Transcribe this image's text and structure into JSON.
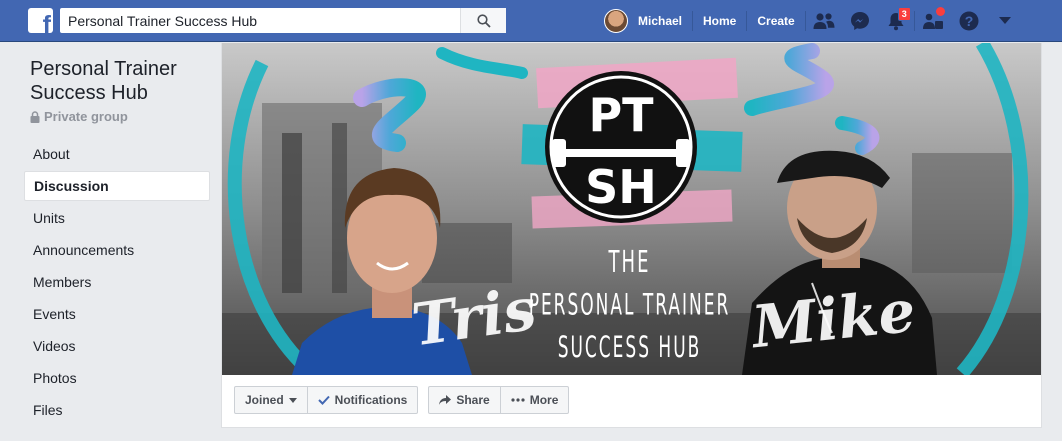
{
  "topbar": {
    "search_value": "Personal Trainer Success Hub",
    "user_name": "Michael",
    "home_label": "Home",
    "create_label": "Create",
    "notifications_count": "3"
  },
  "group": {
    "name_line1": "Personal Trainer",
    "name_line2": "Success Hub",
    "privacy": "Private group"
  },
  "sidebar": {
    "items": [
      {
        "label": "About"
      },
      {
        "label": "Discussion"
      },
      {
        "label": "Units"
      },
      {
        "label": "Announcements"
      },
      {
        "label": "Members"
      },
      {
        "label": "Events"
      },
      {
        "label": "Videos"
      },
      {
        "label": "Photos"
      },
      {
        "label": "Files"
      }
    ]
  },
  "cover": {
    "logo_top": "PT",
    "logo_bottom": "SH",
    "title_line1": "THE",
    "title_line2": "PERSONAL TRAINER",
    "title_line3": "SUCCESS HUB",
    "sig_left": "Tris",
    "sig_right": "Mike"
  },
  "actions": {
    "joined_label": "Joined",
    "notifications_label": "Notifications",
    "share_label": "Share",
    "more_label": "More"
  },
  "colors": {
    "brand": "#4267b2",
    "teal": "#1fb5c2",
    "pink": "#f0a6c6"
  }
}
